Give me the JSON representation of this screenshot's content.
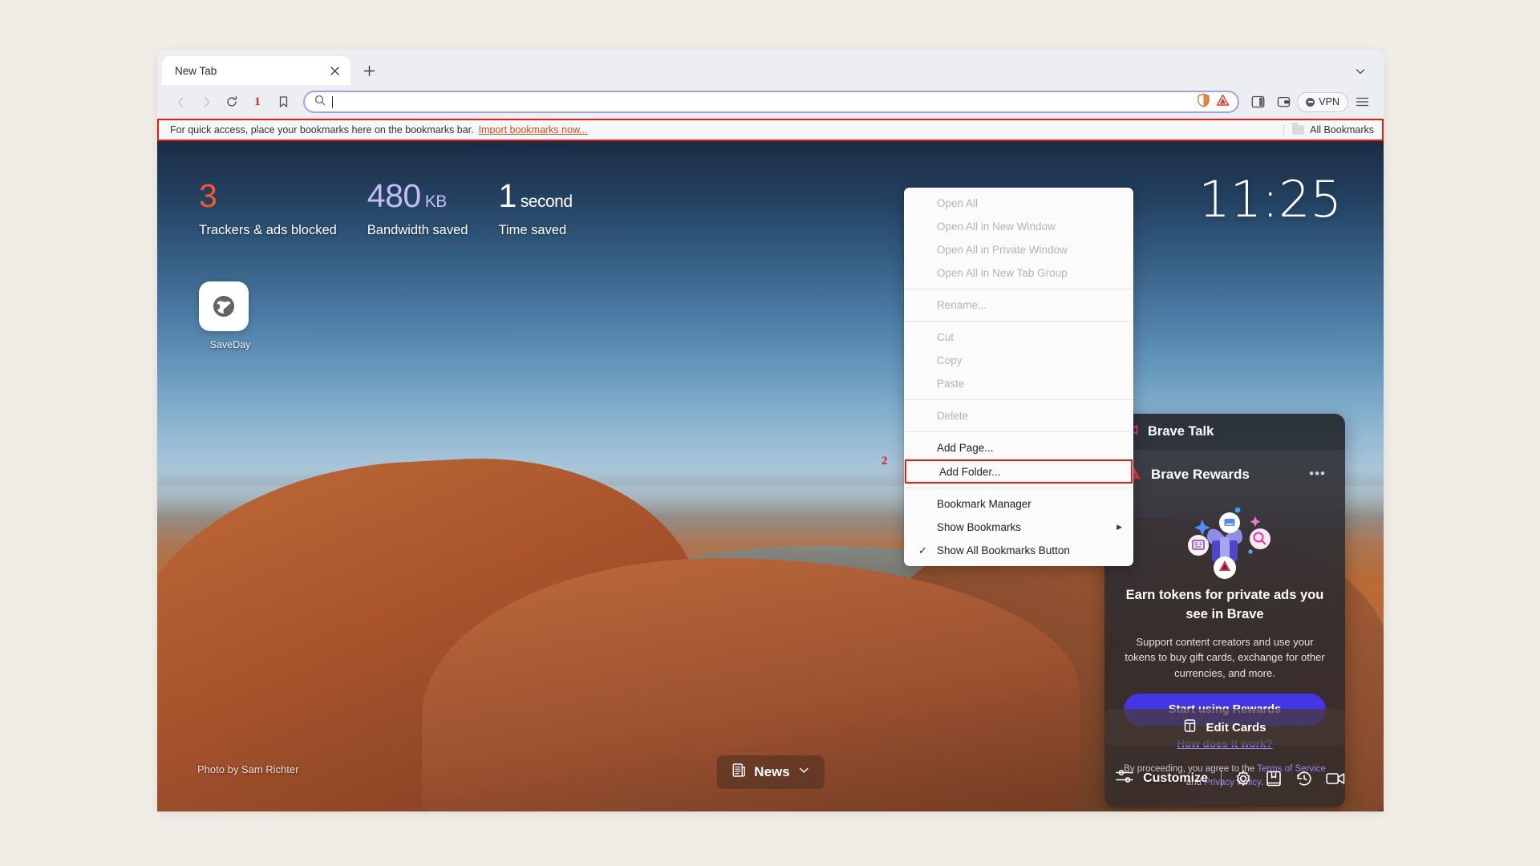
{
  "browser": {
    "tab": {
      "title": "New Tab",
      "close_icon": "close-icon",
      "new_tab_icon": "plus-icon"
    },
    "tabstrip_collapse_icon": "chevron-down-icon",
    "toolbar": {
      "back_icon": "back-arrow-icon",
      "forward_icon": "forward-arrow-icon",
      "reload_icon": "reload-icon",
      "annotation_1": "1",
      "bookmark_icon": "bookmark-icon",
      "search_icon": "search-icon",
      "omnibox_value": "",
      "omnibox_placeholder": "",
      "brave_shields_icon": "shields-icon",
      "brave_rewards_icon": "brave-rewards-triangle-icon",
      "sidebar_icon": "sidebar-panel-icon",
      "wallet_icon": "wallet-icon",
      "vpn_label": "VPN",
      "menu_icon": "hamburger-menu-icon"
    },
    "bookmarks_bar": {
      "hint": "For quick access, place your bookmarks here on the bookmarks bar.",
      "import_link": "Import bookmarks now...",
      "all_bookmarks_label": "All Bookmarks",
      "folder_icon": "folder-icon"
    }
  },
  "context_menu": {
    "annotation_2": "2",
    "items": [
      {
        "label": "Open All",
        "disabled": true,
        "checked": false,
        "submenu": false
      },
      {
        "label": "Open All in New Window",
        "disabled": true,
        "checked": false,
        "submenu": false
      },
      {
        "label": "Open All in Private Window",
        "disabled": true,
        "checked": false,
        "submenu": false
      },
      {
        "label": "Open All in New Tab Group",
        "disabled": true,
        "checked": false,
        "submenu": false
      },
      {
        "label": "Rename...",
        "disabled": true,
        "checked": false,
        "submenu": false
      },
      {
        "label": "Cut",
        "disabled": true,
        "checked": false,
        "submenu": false
      },
      {
        "label": "Copy",
        "disabled": true,
        "checked": false,
        "submenu": false
      },
      {
        "label": "Paste",
        "disabled": true,
        "checked": false,
        "submenu": false
      },
      {
        "label": "Delete",
        "disabled": true,
        "checked": false,
        "submenu": false
      },
      {
        "label": "Add Page...",
        "disabled": false,
        "checked": false,
        "submenu": false
      },
      {
        "label": "Add Folder...",
        "disabled": false,
        "checked": false,
        "submenu": false,
        "highlighted": true
      },
      {
        "label": "Bookmark Manager",
        "disabled": false,
        "checked": false,
        "submenu": false
      },
      {
        "label": "Show Bookmarks",
        "disabled": false,
        "checked": false,
        "submenu": true
      },
      {
        "label": "Show All Bookmarks Button",
        "disabled": false,
        "checked": true,
        "submenu": false
      }
    ]
  },
  "new_tab_page": {
    "stats": [
      {
        "value": "3",
        "unit": "",
        "label": "Trackers & ads blocked",
        "color": "#fb542b"
      },
      {
        "value": "480",
        "unit": "KB",
        "label": "Bandwidth saved",
        "color": "#c3bdf5"
      },
      {
        "value": "1",
        "unit": "second",
        "label": "Time saved",
        "color": "#ffffff"
      }
    ],
    "shortcuts": [
      {
        "label": "SaveDay",
        "icon": "globe-icon"
      }
    ],
    "clock": "11:25",
    "photo_credit": "Photo by Sam Richter",
    "news": {
      "label": "News",
      "icon": "news-icon",
      "chevron": "chevron-down-icon"
    },
    "bottom_bar": {
      "customize_label": "Customize",
      "customize_icon": "sliders-icon",
      "settings_icon": "gear-icon",
      "bookmarks_icon": "bookmarks-icon",
      "history_icon": "history-clock-icon",
      "brave_talk_icon": "video-camera-icon"
    },
    "cards": {
      "brave_talk": {
        "title": "Brave Talk",
        "icon": "video-camera-icon"
      },
      "brave_rewards": {
        "title": "Brave Rewards",
        "icon": "brave-rewards-triangle-icon",
        "more_icon": "more-options-icon",
        "headline": "Earn tokens for private ads you see in Brave",
        "body": "Support content creators and use your tokens to buy gift cards, exchange for other currencies, and more.",
        "cta_label": "Start using Rewards",
        "how_link": "How does it work?",
        "legal_prefix": "By proceeding, you agree to the ",
        "legal_terms": "Terms of Service",
        "legal_and": " and ",
        "legal_privacy": "Privacy Policy",
        "legal_suffix": "."
      }
    },
    "edit_cards": {
      "label": "Edit Cards",
      "icon": "cards-icon"
    }
  },
  "colors": {
    "accent_purple": "#4236e8",
    "annotation_red": "#f1190f",
    "tracker_orange": "#fb542b",
    "bandwidth_lilac": "#c3bdf5"
  }
}
